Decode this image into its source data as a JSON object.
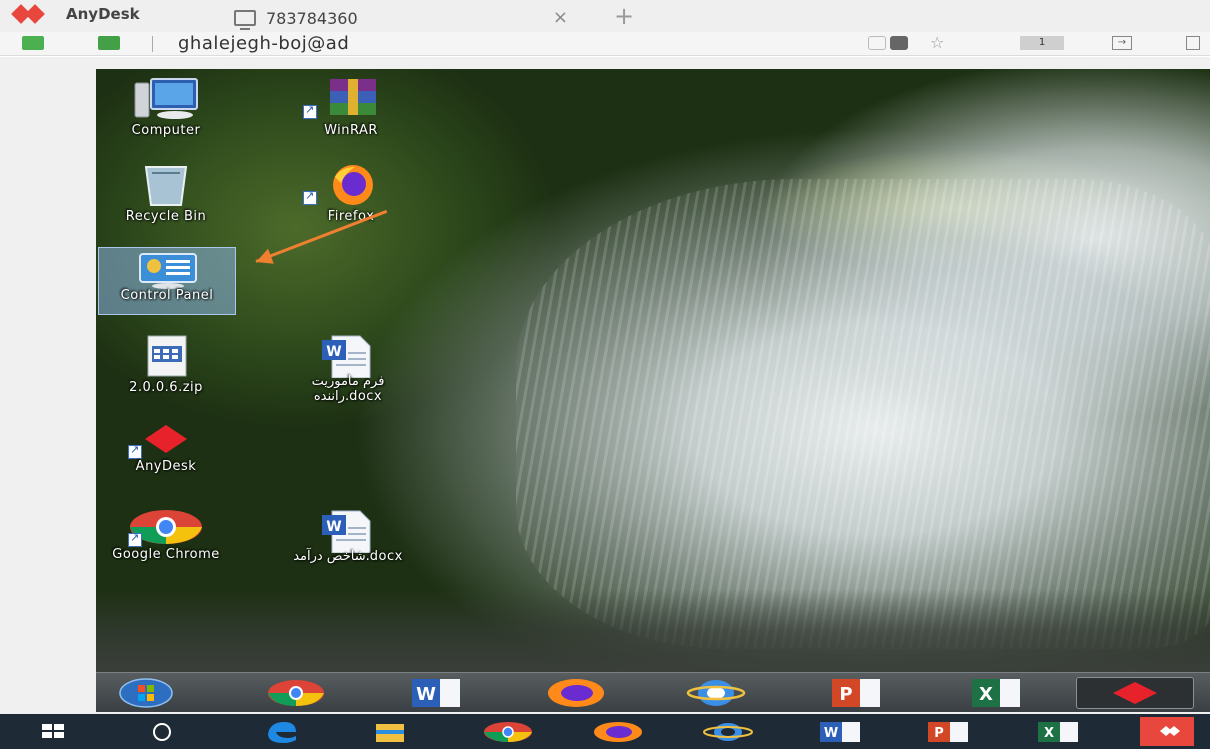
{
  "app": {
    "name": "AnyDesk",
    "tab_label": "783784360",
    "tab_close": "×",
    "new_tab": "+"
  },
  "address_bar": {
    "address": "ghalejegh-boj@ad",
    "monitor_number": "1"
  },
  "desktop_icons": [
    {
      "label": "Computer",
      "icon": "computer-icon"
    },
    {
      "label": "WinRAR",
      "icon": "winrar-icon"
    },
    {
      "label": "Recycle Bin",
      "icon": "recycle-bin-icon"
    },
    {
      "label": "Firefox",
      "icon": "firefox-icon"
    },
    {
      "label": "Control Panel",
      "icon": "control-panel-icon",
      "selected": true
    },
    {
      "label": "2.0.0.6.zip",
      "icon": "zip-file-icon"
    },
    {
      "label": "فرم ماموریت راننده.docx",
      "icon": "word-document-icon"
    },
    {
      "label": "AnyDesk",
      "icon": "anydesk-icon"
    },
    {
      "label": "Google Chrome",
      "icon": "chrome-icon"
    },
    {
      "label": "شاخص درآمد.docx",
      "icon": "word-document-icon"
    }
  ],
  "remote_taskbar": [
    "start-orb-icon",
    "chrome-icon",
    "word-icon",
    "firefox-icon",
    "internet-explorer-icon",
    "powerpoint-icon",
    "excel-icon",
    "anydesk-icon"
  ],
  "host_taskbar": [
    "windows-start-icon",
    "search-circle-icon",
    "edge-icon",
    "file-explorer-icon",
    "chrome-icon",
    "firefox-icon",
    "internet-explorer-icon",
    "word-icon",
    "powerpoint-icon",
    "excel-icon",
    "anydesk-icon"
  ],
  "colors": {
    "anydesk_red": "#e8473e",
    "annotation_arrow": "#f08030",
    "host_taskbar": "#1f2a37"
  }
}
